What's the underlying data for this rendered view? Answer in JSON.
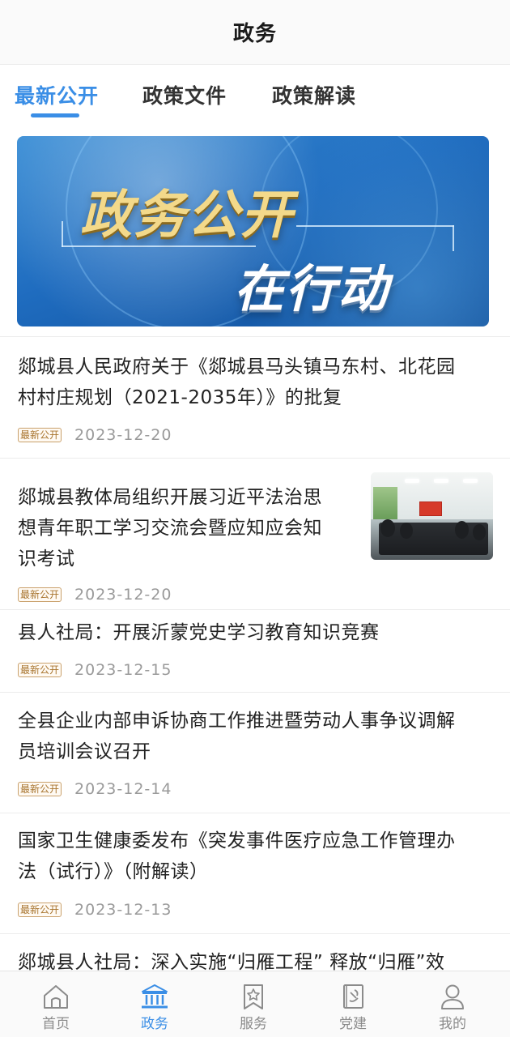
{
  "header": {
    "title": "政务"
  },
  "tabs": [
    {
      "label": "最新公开",
      "active": true
    },
    {
      "label": "政策文件",
      "active": false
    },
    {
      "label": "政策解读",
      "active": false
    }
  ],
  "banner": {
    "line1": "政务公开",
    "line2": "在行动"
  },
  "articles": [
    {
      "title_lines": [
        "郯城县人民政府关于《郯城县马头镇马东村、北花园",
        "村村庄规划（2021-2035年）》的批复"
      ],
      "tag": "最新公开",
      "date": "2023-12-20",
      "has_thumbnail": false
    },
    {
      "title_lines": [
        "郯城县教体局组织开展习近平法治思",
        "想青年职工学习交流会暨应知应会知",
        "识考试"
      ],
      "tag": "最新公开",
      "date": "2023-12-20",
      "has_thumbnail": true
    },
    {
      "title_lines": [
        "县人社局：开展沂蒙党史学习教育知识竞赛"
      ],
      "tag": "最新公开",
      "date": "2023-12-15",
      "has_thumbnail": false
    },
    {
      "title_lines": [
        "全县企业内部申诉协商工作推进暨劳动人事争议调解",
        "员培训会议召开"
      ],
      "tag": "最新公开",
      "date": "2023-12-14",
      "has_thumbnail": false
    },
    {
      "title_lines": [
        "国家卫生健康委发布《突发事件医疗应急工作管理办",
        "法（试行）》（附解读）"
      ],
      "tag": "最新公开",
      "date": "2023-12-13",
      "has_thumbnail": false
    },
    {
      "title_lines": [
        "郯城县人社局：深入实施“归雁工程” 释放“归雁”效"
      ],
      "tag": "",
      "date": "",
      "has_thumbnail": false
    }
  ],
  "tabbar": [
    {
      "label": "首页",
      "icon": "home-icon",
      "active": false
    },
    {
      "label": "政务",
      "icon": "government-building-icon",
      "active": true
    },
    {
      "label": "服务",
      "icon": "star-bookmark-icon",
      "active": false
    },
    {
      "label": "党建",
      "icon": "party-emblem-book-icon",
      "active": false
    },
    {
      "label": "我的",
      "icon": "user-profile-icon",
      "active": false
    }
  ],
  "colors": {
    "accent": "#3a8ee6",
    "tag_text": "#a8742e",
    "date_text": "#9a9a9a",
    "inactive_tab": "#8b8b8b"
  }
}
